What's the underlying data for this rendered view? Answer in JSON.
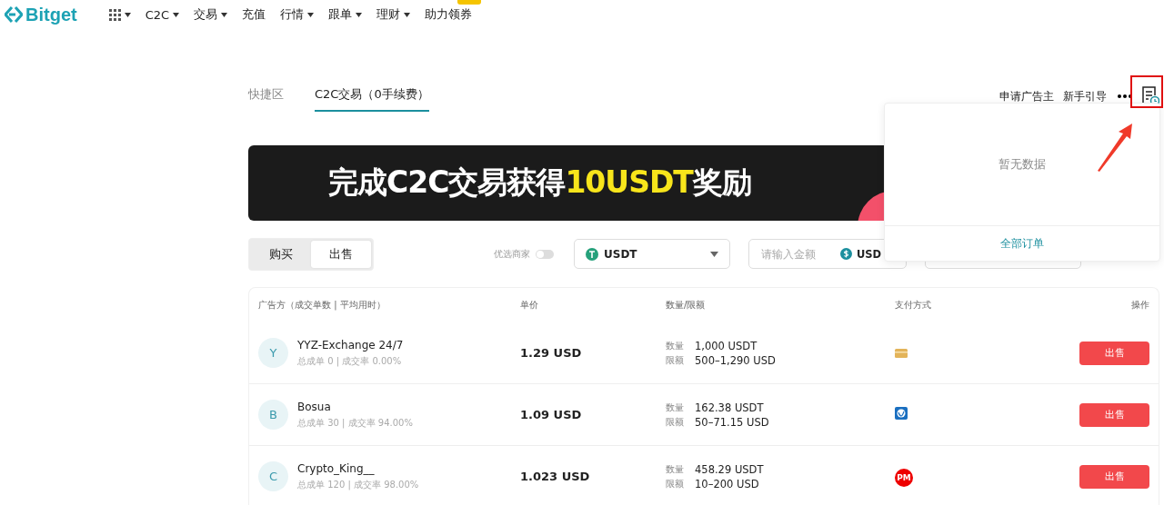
{
  "nav": {
    "logo": "Bitget",
    "items": [
      {
        "kind": "apps",
        "has_menu": true
      },
      {
        "kind": "text",
        "label": "C2C",
        "has_menu": true
      },
      {
        "kind": "text",
        "label": "交易",
        "has_menu": true
      },
      {
        "kind": "text",
        "label": "充值",
        "has_menu": false
      },
      {
        "kind": "text",
        "label": "行情",
        "has_menu": true
      },
      {
        "kind": "text",
        "label": "跟单",
        "has_menu": true
      },
      {
        "kind": "text",
        "label": "理财",
        "has_menu": true
      },
      {
        "kind": "text",
        "label": "助力领券",
        "has_menu": false,
        "badge": true
      }
    ]
  },
  "tabs": [
    {
      "label": "快捷区",
      "selected": false
    },
    {
      "label": "C2C交易（0手续费）",
      "selected": true
    }
  ],
  "top_links": [
    "申请广告主",
    "新手引导"
  ],
  "banner": {
    "segments": [
      {
        "text": "完成C2C交易获得",
        "highlight": false
      },
      {
        "text": "10USDT",
        "highlight": true
      },
      {
        "text": "奖励",
        "highlight": false
      }
    ]
  },
  "trade_side": [
    {
      "label": "购买",
      "selected": false
    },
    {
      "label": "出售",
      "selected": true
    }
  ],
  "preferred_merchant": {
    "label": "优选商家",
    "on": false
  },
  "coin_select": {
    "value": "USDT"
  },
  "amount_field": {
    "placeholder": "请输入金额",
    "currency": "USD"
  },
  "table": {
    "columns": [
      "广告方（成交单数 | 平均用时）",
      "单价",
      "数量/限额",
      "支付方式",
      "操作"
    ],
    "rows": [
      {
        "avatar": "Y",
        "name": "YYZ-Exchange 24/7",
        "stats": "总成单 0 | 成交率 0.00%",
        "price": "1.29 USD",
        "quantity_label": "数量",
        "quantity": "1,000 USDT",
        "limit_label": "限额",
        "limit": "500–1,290 USD",
        "payment": {
          "kind": "card"
        },
        "action": "出售"
      },
      {
        "avatar": "B",
        "name": "Bosua",
        "stats": "总成单 30 | 成交率 94.00%",
        "price": "1.09 USD",
        "quantity_label": "数量",
        "quantity": "162.38 USDT",
        "limit_label": "限额",
        "limit": "50–71.15 USD",
        "payment": {
          "kind": "globe"
        },
        "action": "出售"
      },
      {
        "avatar": "C",
        "name": "Crypto_King__",
        "stats": "总成单 120 | 成交率 98.00%",
        "price": "1.023 USD",
        "quantity_label": "数量",
        "quantity": "458.29 USDT",
        "limit_label": "限额",
        "limit": "10–200 USD",
        "payment": {
          "kind": "pm",
          "label": "PM"
        },
        "action": "出售"
      }
    ]
  },
  "orders_popup": {
    "empty_text": "暂无数据",
    "link": "全部订单"
  }
}
